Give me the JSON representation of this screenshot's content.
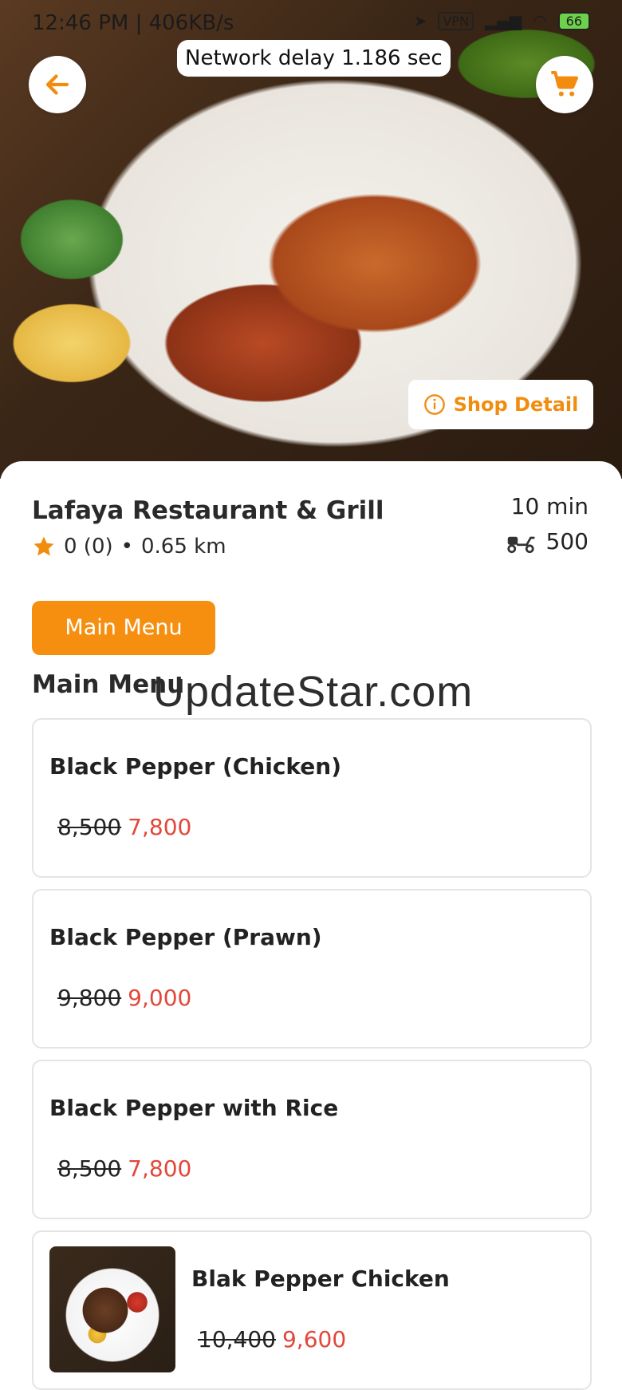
{
  "status_bar": {
    "time_speed": "12:46 PM | 406KB/s",
    "vpn": "VPN",
    "battery": "66"
  },
  "network_delay": "Network delay 1.186 sec",
  "shop_detail_label": "Shop Detail",
  "restaurant": {
    "name": "Lafaya Restaurant & Grill",
    "rating": "0 (0)",
    "separator": "•",
    "distance": "0.65 km",
    "eta": "10 min",
    "delivery_fee": "500"
  },
  "menu_button": "Main Menu",
  "section_title": "Main Menu",
  "watermark": "UpdateStar.com",
  "items": [
    {
      "name": "Black Pepper (Chicken)",
      "old_price": "8,500",
      "new_price": "7,800"
    },
    {
      "name": "Black Pepper (Prawn)",
      "old_price": "9,800",
      "new_price": "9,000"
    },
    {
      "name": "Black Pepper with Rice",
      "old_price": "8,500",
      "new_price": "7,800"
    },
    {
      "name": "Blak Pepper Chicken",
      "old_price": "10,400",
      "new_price": "9,600"
    }
  ],
  "colors": {
    "accent": "#f68f0f",
    "price_new": "#e2473a"
  },
  "icons": [
    "arrow-left-icon",
    "cart-icon",
    "info-icon",
    "star-icon",
    "scooter-icon"
  ]
}
